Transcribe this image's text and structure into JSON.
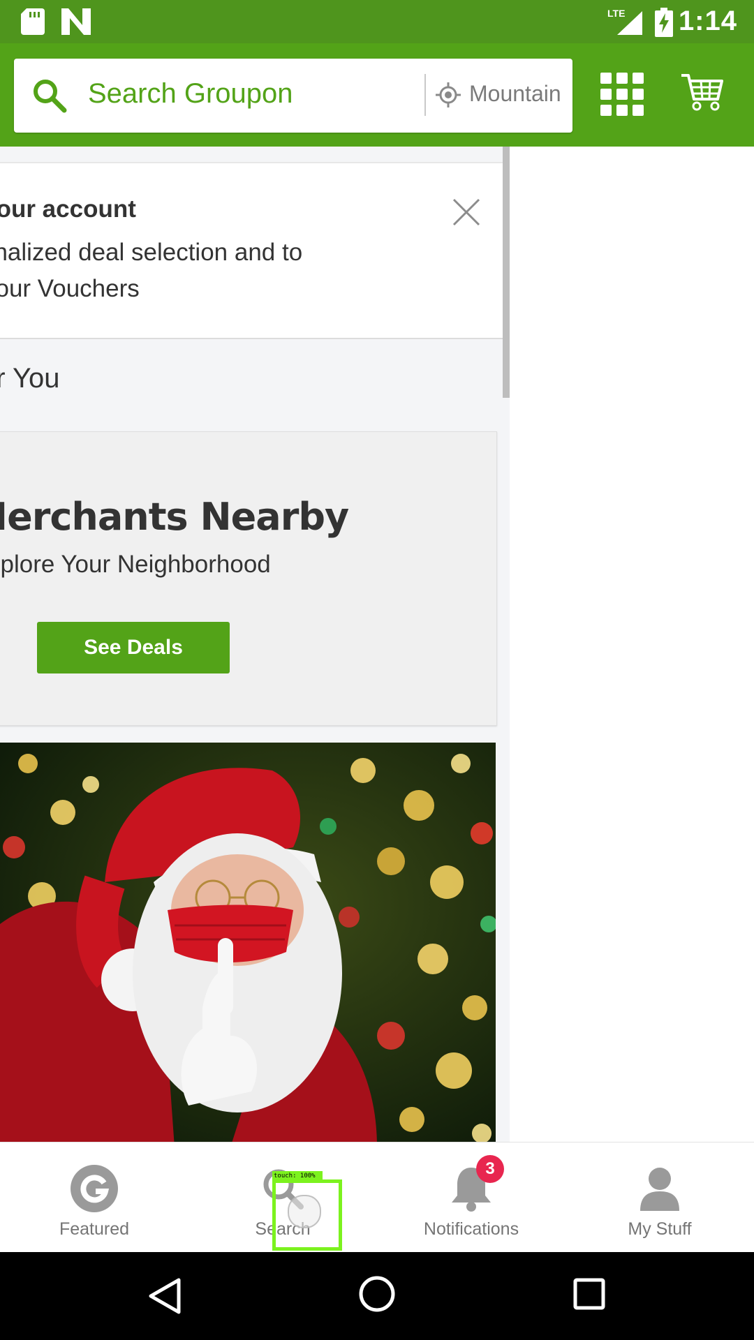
{
  "status_bar": {
    "time": "1:14",
    "network": "LTE"
  },
  "header": {
    "search_placeholder": "Search Groupon",
    "location": "Mountain View"
  },
  "signin_banner": {
    "title": "o your account",
    "line1": "onalized deal selection and to",
    "line2": "your Vouchers"
  },
  "section": {
    "title": "or You"
  },
  "promo_card": {
    "headline": "of Merchants Nearby",
    "subtitle": "xplore Your Neighborhood",
    "button_label": "See Deals"
  },
  "photo": {
    "subject": "santa-with-mask"
  },
  "bottom_nav": {
    "items": [
      {
        "label": "Featured",
        "icon": "groupon-g-icon"
      },
      {
        "label": "Search",
        "icon": "search-icon"
      },
      {
        "label": "Notifications",
        "icon": "bell-icon",
        "badge": "3"
      },
      {
        "label": "My Stuff",
        "icon": "person-icon"
      }
    ]
  },
  "touch_overlay": {
    "label": "touch: 100%"
  },
  "colors": {
    "brand_green": "#53a318",
    "status_green": "#4f951d",
    "badge_red": "#e8264f"
  }
}
